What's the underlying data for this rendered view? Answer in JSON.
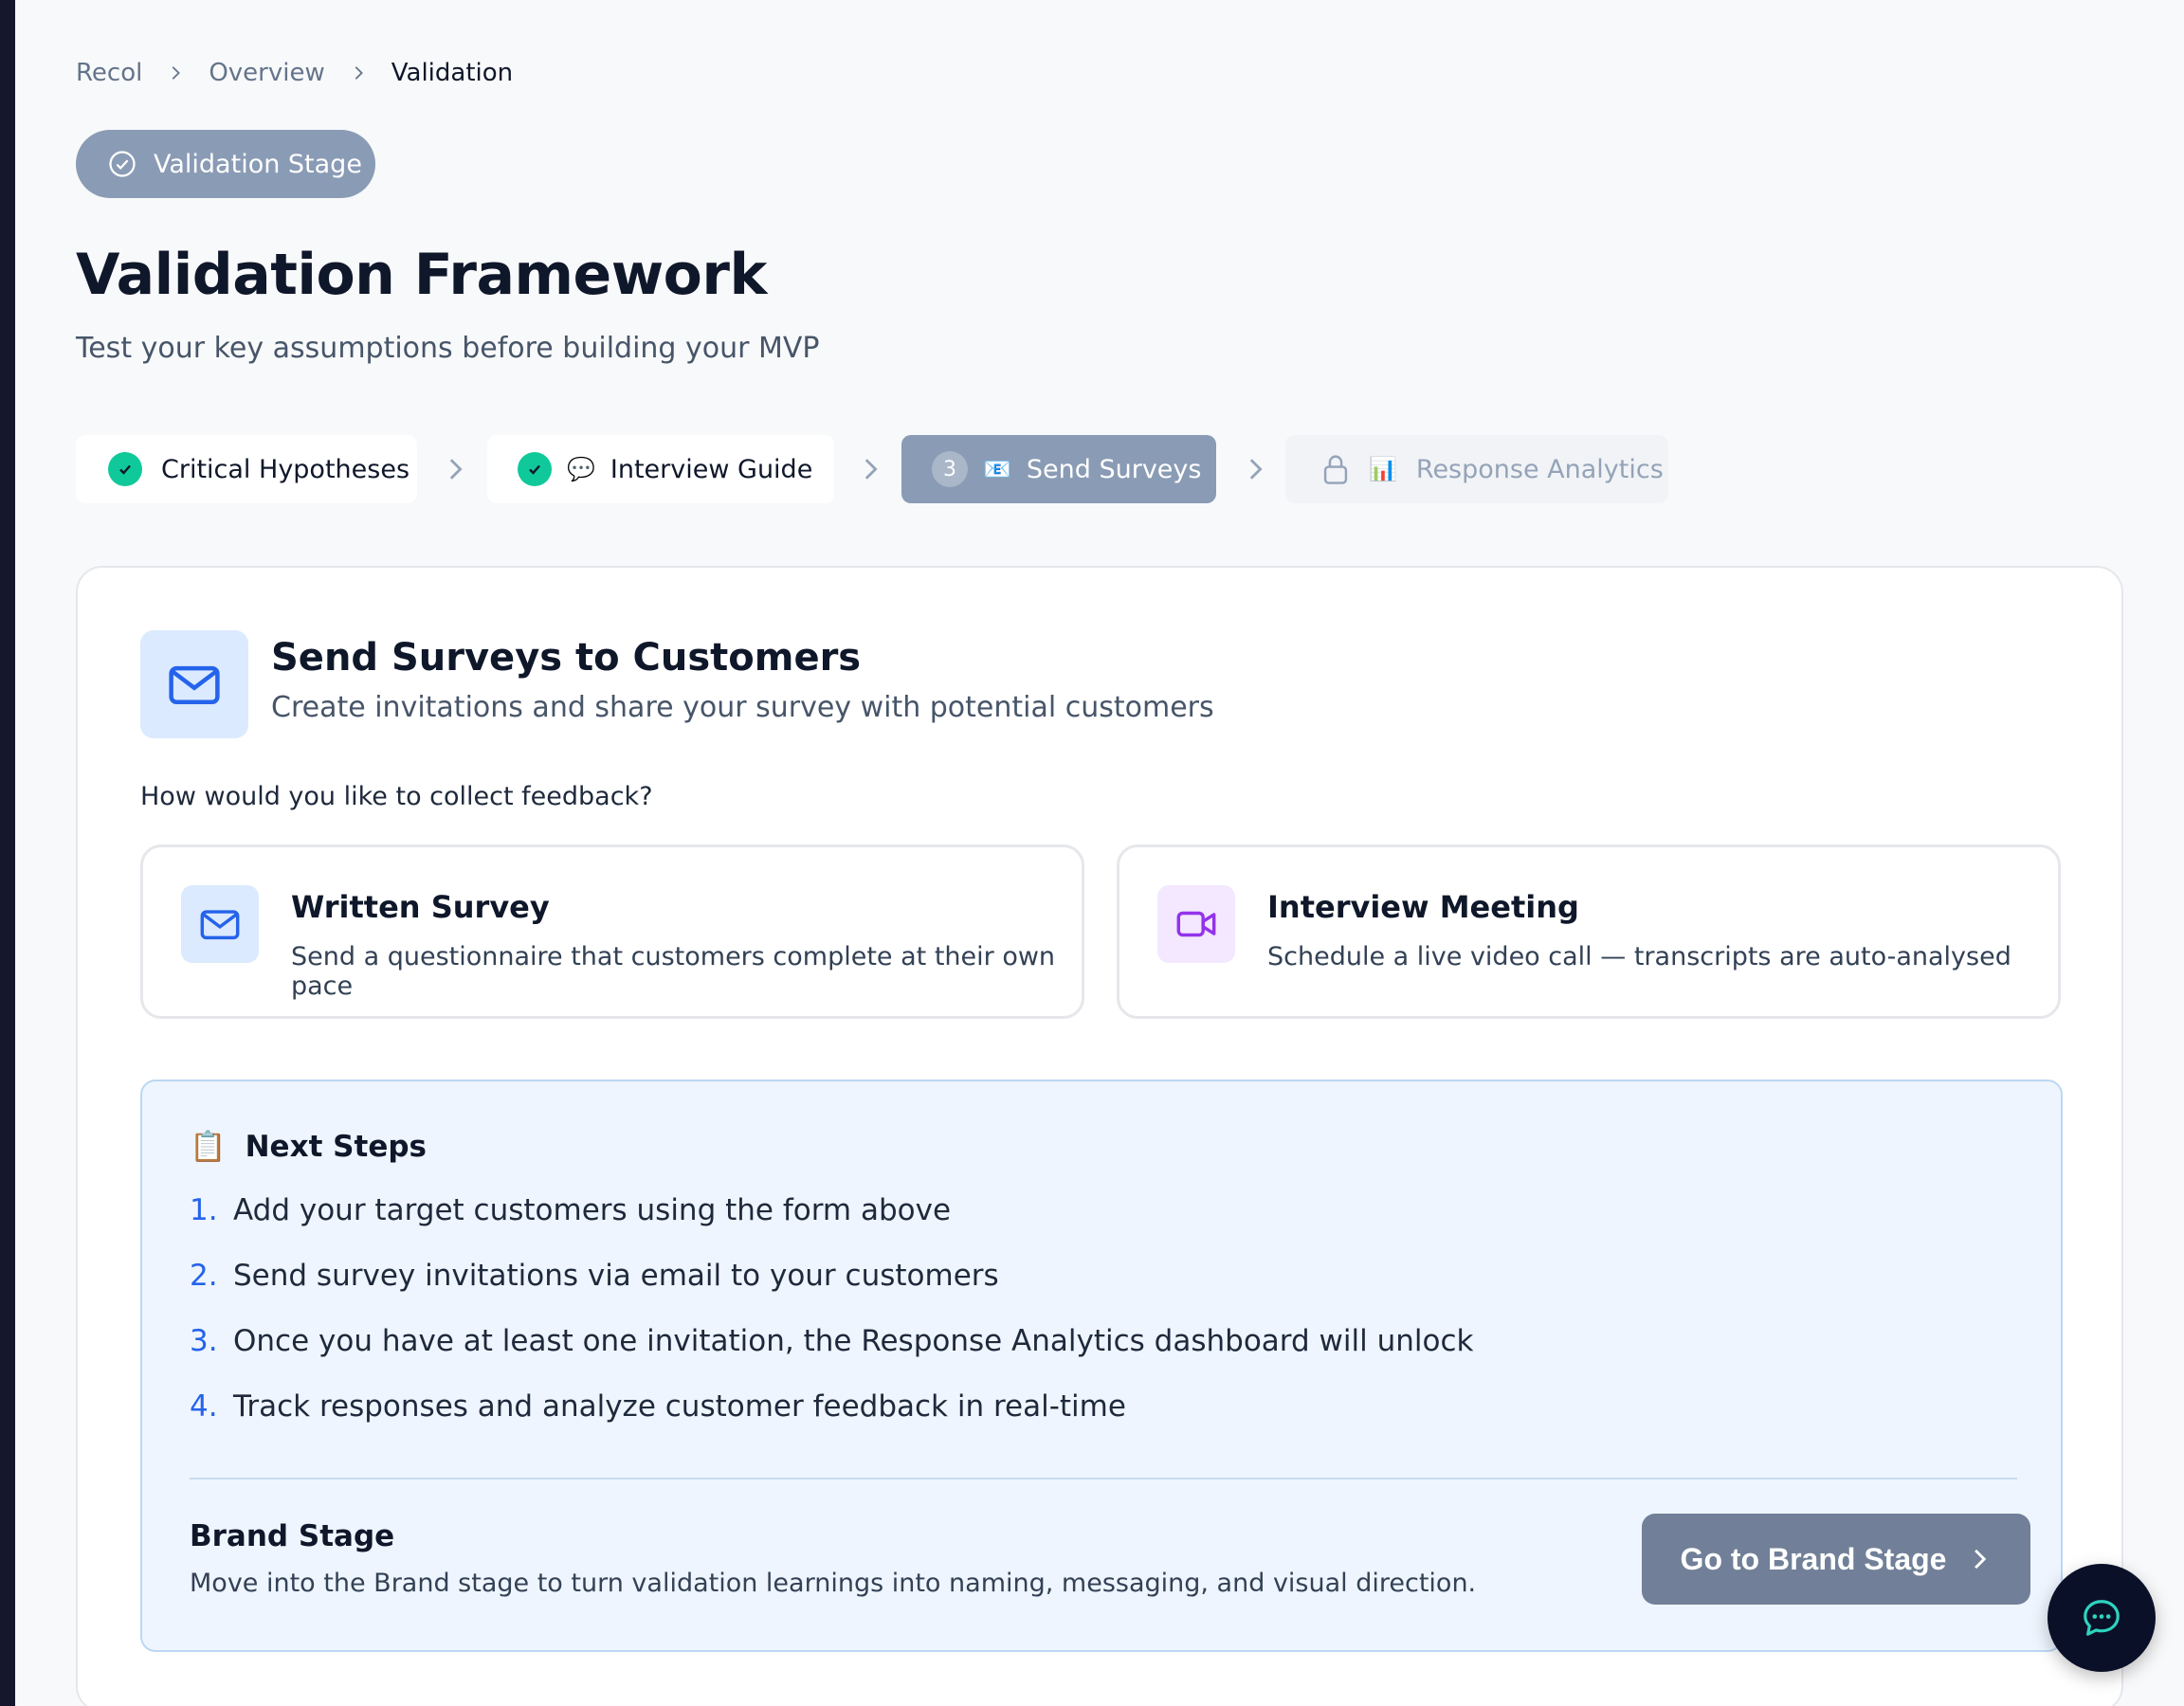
{
  "breadcrumb": {
    "items": [
      "Recol",
      "Overview"
    ],
    "current": "Validation"
  },
  "stage_pill": {
    "label": "Validation Stage",
    "icon": "check-circle-icon"
  },
  "header": {
    "title": "Validation Framework",
    "subtitle": "Test your key assumptions before building your MVP"
  },
  "steps": [
    {
      "label": "Critical Hypotheses",
      "state": "completed"
    },
    {
      "label": "Interview Guide",
      "state": "completed",
      "emoji": "💬"
    },
    {
      "label": "Send Surveys",
      "state": "active",
      "number": "3",
      "emoji": "📧"
    },
    {
      "label": "Response Analytics",
      "state": "locked",
      "emoji": "📊"
    }
  ],
  "card": {
    "title": "Send Surveys to Customers",
    "subtitle": "Create invitations and share your survey with potential customers",
    "question": "How would you like to collect feedback?",
    "options": [
      {
        "title": "Written Survey",
        "description": "Send a questionnaire that customers complete at their own pace",
        "icon": "mail-icon",
        "accent": "#2563eb"
      },
      {
        "title": "Interview Meeting",
        "description": "Schedule a live video call — transcripts are auto-analysed",
        "icon": "video-icon",
        "accent": "#9333ea"
      }
    ]
  },
  "next_steps": {
    "emoji": "📋",
    "title": "Next Steps",
    "items": [
      {
        "n": "1.",
        "text": "Add your target customers using the form above"
      },
      {
        "n": "2.",
        "text": "Send survey invitations via email to your customers"
      },
      {
        "n": "3.",
        "text": "Once you have at least one invitation, the Response Analytics dashboard will unlock"
      },
      {
        "n": "4.",
        "text": "Track responses and analyze customer feedback in real-time"
      }
    ]
  },
  "brand": {
    "title": "Brand Stage",
    "description": "Move into the Brand stage to turn validation learnings into naming, messaging, and visual direction.",
    "button_label": "Go to Brand Stage"
  },
  "colors": {
    "accent_slate": "#8a9bb5",
    "success": "#10c99a",
    "link_blue": "#2563eb"
  }
}
